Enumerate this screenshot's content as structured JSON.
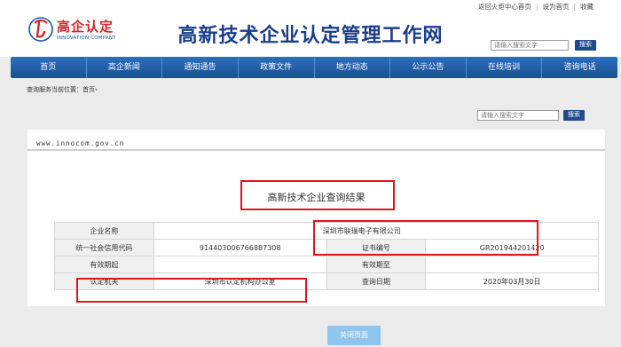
{
  "header": {
    "logo_cn": "高企认定",
    "logo_en": "INNOVATION COMPANY",
    "site_title": "高新技术企业认定管理工作网",
    "top_links": [
      "返回火炬中心首页",
      "设为首页",
      "收藏"
    ],
    "search_placeholder": "请输入搜索文字",
    "search_button": "搜索"
  },
  "nav": {
    "items": [
      "首页",
      "高企新闻",
      "通知通告",
      "政策文件",
      "地方动态",
      "公示公告",
      "在线培训",
      "咨询电话"
    ]
  },
  "breadcrumb": {
    "prefix": "查询服务当前位置：",
    "home": "首页",
    "sep": "›"
  },
  "search2": {
    "placeholder": "请输入搜索文字",
    "button": "搜索"
  },
  "panel": {
    "domain": "www.innocom.gov.cn",
    "result_title": "高新技术企业查询结果"
  },
  "table": {
    "rows": [
      [
        {
          "label": "企业名称",
          "value": "深圳市联瑞电子有限公司",
          "span": true
        }
      ],
      [
        {
          "label": "统一社会信用代码",
          "value": "914403006766887308"
        },
        {
          "label": "证书编号",
          "value": "GR201944201420"
        }
      ],
      [
        {
          "label": "有效期起",
          "value": ""
        },
        {
          "label": "有效期至",
          "value": ""
        }
      ],
      [
        {
          "label": "认定机关",
          "value": "深圳市认定机构办公室"
        },
        {
          "label": "查询日期",
          "value": "2020年03月30日"
        }
      ]
    ]
  },
  "close_button": "关闭页面",
  "colors": {
    "nav_bg": "#1f5aa6",
    "highlight": "#e0151b",
    "title_blue": "#1a3e8c",
    "logo_red": "#d3262c"
  }
}
